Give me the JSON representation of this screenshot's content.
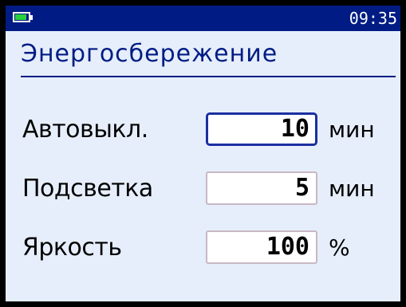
{
  "status": {
    "time": "09:35",
    "battery_level": 0.85,
    "battery_color": "#29d13d"
  },
  "title": "Энергосбережение",
  "settings": [
    {
      "label": "Автовыкл.",
      "value": "10",
      "unit": "мин",
      "active": true
    },
    {
      "label": "Подсветка",
      "value": "5",
      "unit": "мин",
      "active": false
    },
    {
      "label": "Яркость",
      "value": "100",
      "unit": "%",
      "active": false
    }
  ],
  "colors": {
    "accent": "#001c84",
    "background": "#e6eefb",
    "field_border": "#c8b8c4",
    "active_border": "#1b2fa0"
  }
}
